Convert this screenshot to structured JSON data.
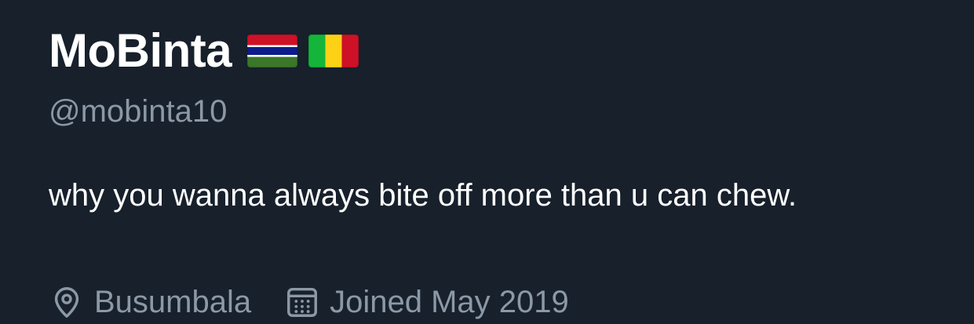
{
  "profile": {
    "display_name": "MoBinta",
    "flags": [
      "gambia-flag-icon",
      "mali-flag-icon"
    ],
    "handle": "@mobinta10",
    "bio": "why you wanna always bite off more than u can chew.",
    "location": "Busumbala",
    "joined": "Joined May 2019"
  },
  "colors": {
    "background": "#17202b",
    "primary_text": "#ffffff",
    "secondary_text": "#8b98a5"
  },
  "icons": {
    "location": "location-pin-icon",
    "joined": "calendar-icon"
  }
}
